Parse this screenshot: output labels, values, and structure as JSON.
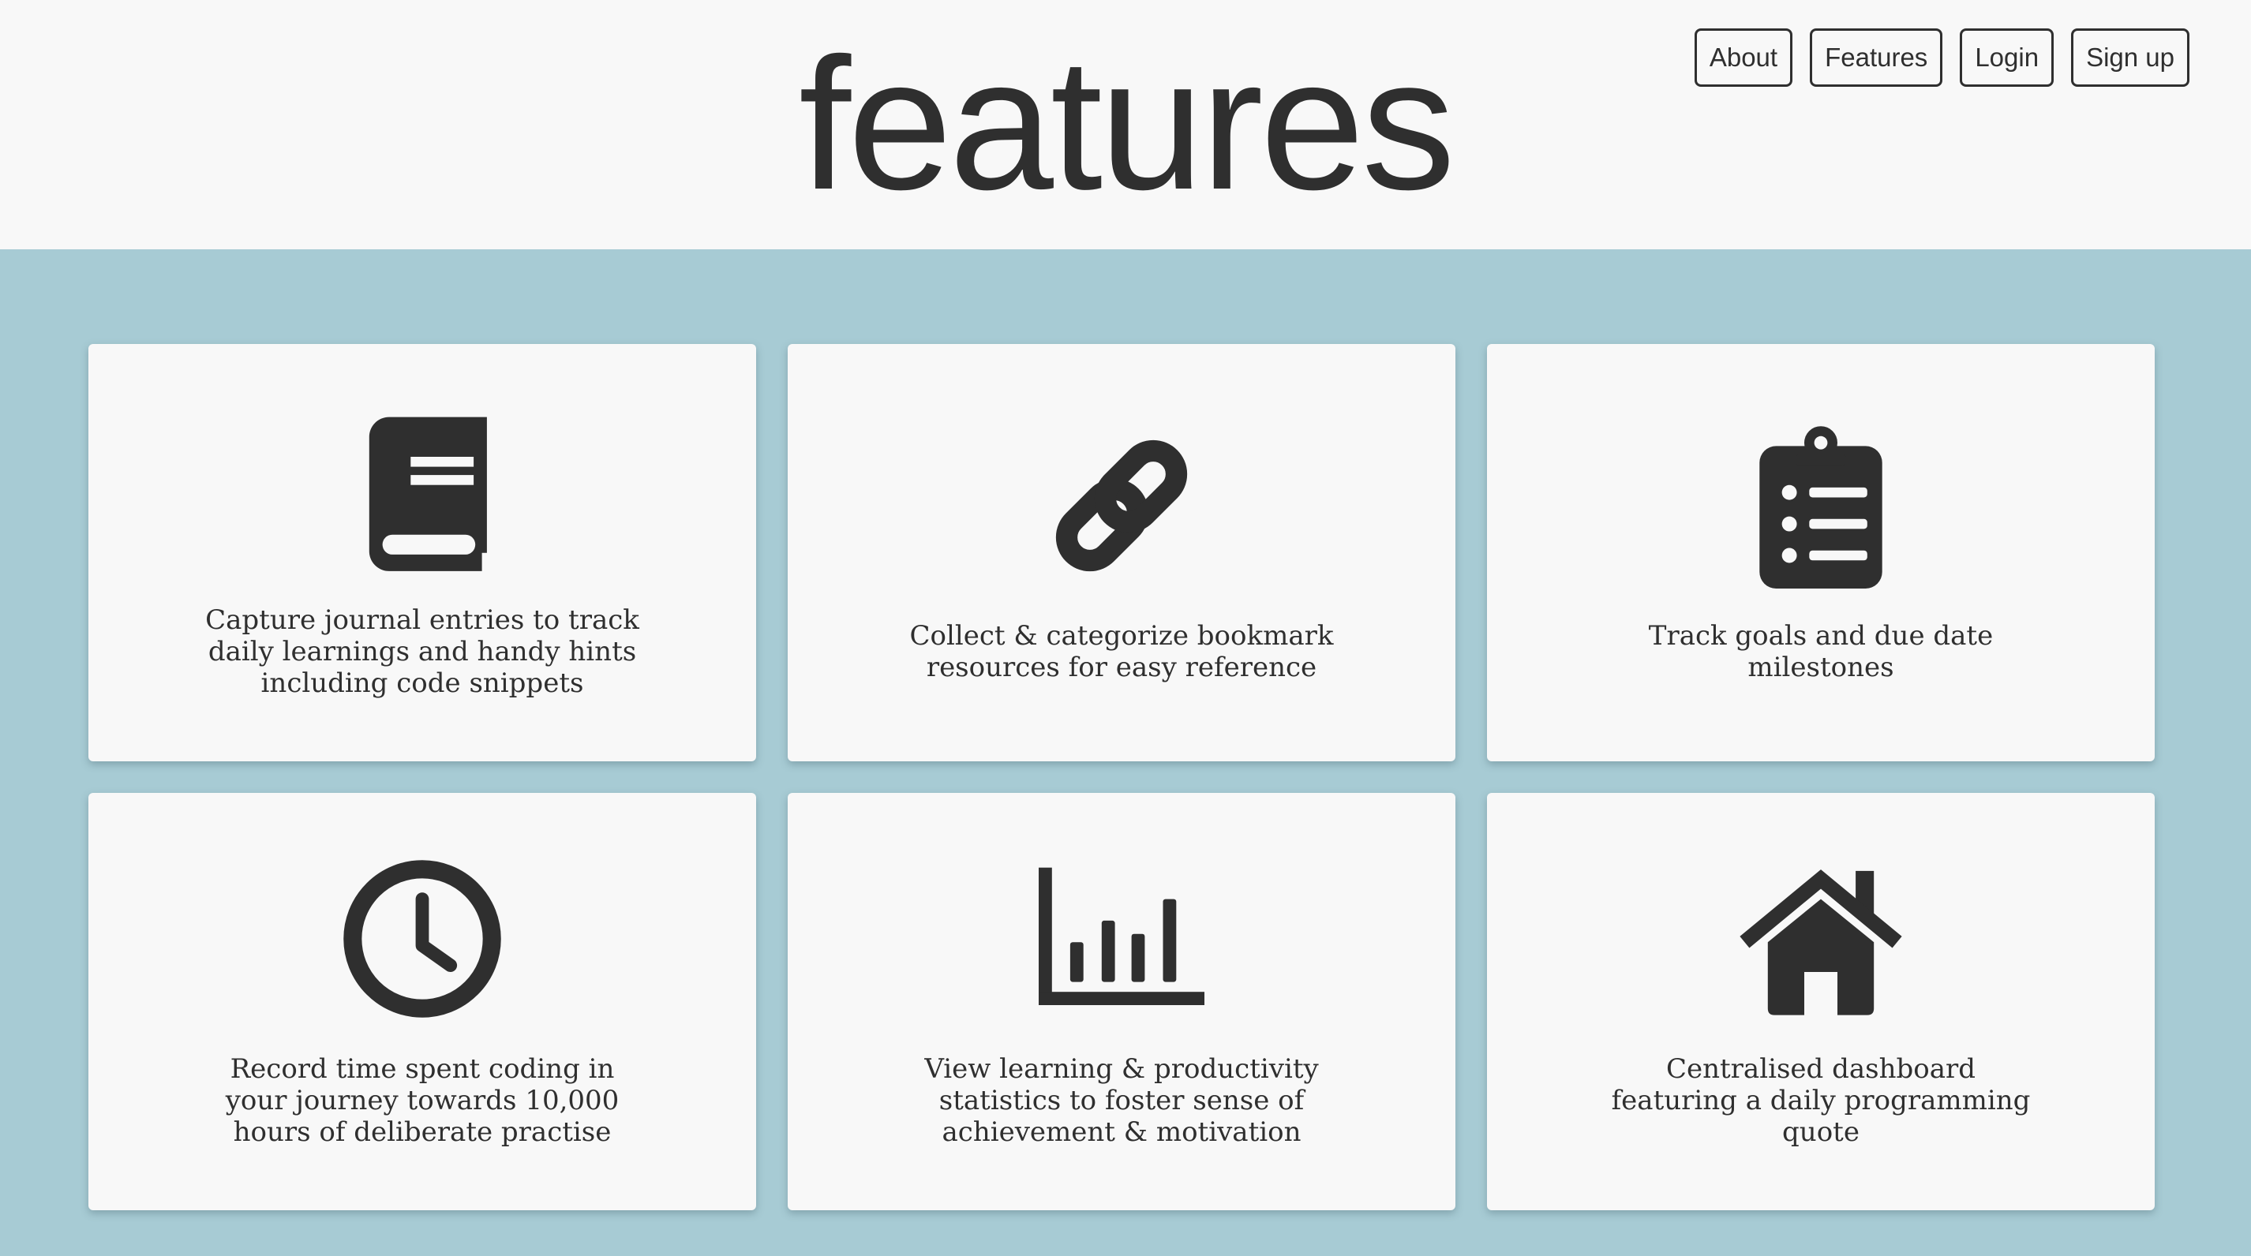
{
  "header": {
    "title": "features"
  },
  "nav": [
    {
      "label": "About"
    },
    {
      "label": "Features"
    },
    {
      "label": "Login"
    },
    {
      "label": "Sign up"
    }
  ],
  "cards": [
    {
      "icon": "book-icon",
      "text": "Capture journal entries to track daily learnings and handy hints including code snippets"
    },
    {
      "icon": "link-icon",
      "text": "Collect & categorize bookmark resources for easy reference"
    },
    {
      "icon": "clipboard-list-icon",
      "text": "Track goals and due date milestones"
    },
    {
      "icon": "clock-icon",
      "text": "Record time spent coding in your journey towards 10,000 hours of deliberate practise"
    },
    {
      "icon": "bar-chart-icon",
      "text": "View learning & productivity statistics to foster sense of achievement & motivation"
    },
    {
      "icon": "home-icon",
      "text": "Centralised dashboard featuring a daily programming quote"
    }
  ],
  "colors": {
    "background": "#a7cbd4",
    "surface": "#f8f8f8",
    "ink": "#2f2f2f"
  }
}
